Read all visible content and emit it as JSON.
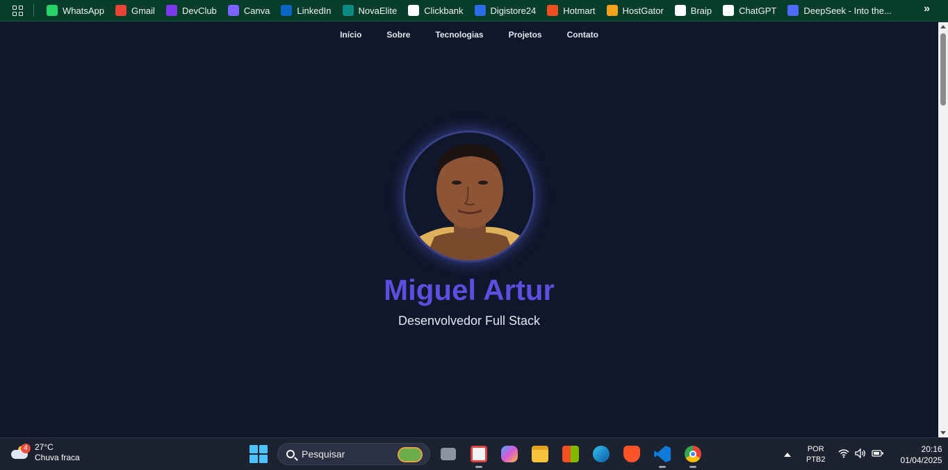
{
  "bookmarks": [
    {
      "label": "WhatsApp",
      "icon": "whatsapp-icon",
      "color": "#25d366"
    },
    {
      "label": "Gmail",
      "icon": "gmail-icon",
      "color": "#ea4335"
    },
    {
      "label": "DevClub",
      "icon": "devclub-icon",
      "color": "#7c3aed"
    },
    {
      "label": "Canva",
      "icon": "canva-icon",
      "color": "#7b61ff"
    },
    {
      "label": "LinkedIn",
      "icon": "linkedin-icon",
      "color": "#0a66c2"
    },
    {
      "label": "NovaElite",
      "icon": "novaelite-icon",
      "color": "#0b8a84"
    },
    {
      "label": "Clickbank",
      "icon": "clickbank-icon",
      "color": "#ffffff"
    },
    {
      "label": "Digistore24",
      "icon": "digistore24-icon",
      "color": "#2b6de8"
    },
    {
      "label": "Hotmart",
      "icon": "hotmart-icon",
      "color": "#f04e23"
    },
    {
      "label": "HostGator",
      "icon": "hostgator-icon",
      "color": "#f7a21b"
    },
    {
      "label": "Braip",
      "icon": "braip-icon",
      "color": "#ffffff"
    },
    {
      "label": "ChatGPT",
      "icon": "chatgpt-icon",
      "color": "#ffffff"
    },
    {
      "label": "DeepSeek - Into the...",
      "icon": "deepseek-icon",
      "color": "#4d6bfe"
    }
  ],
  "nav": {
    "items": [
      "Início",
      "Sobre",
      "Tecnologias",
      "Projetos",
      "Contato"
    ]
  },
  "hero": {
    "name": "Miguel Artur",
    "role": "Desenvolvedor Full Stack",
    "name_color": "#5b4fe0"
  },
  "taskbar": {
    "weather": {
      "badge": "4",
      "temp": "27°C",
      "condition": "Chuva fraca"
    },
    "search_placeholder": "Pesquisar",
    "language": {
      "line1": "POR",
      "line2": "PTB2"
    },
    "clock": {
      "time": "20:16",
      "date": "01/04/2025"
    }
  }
}
